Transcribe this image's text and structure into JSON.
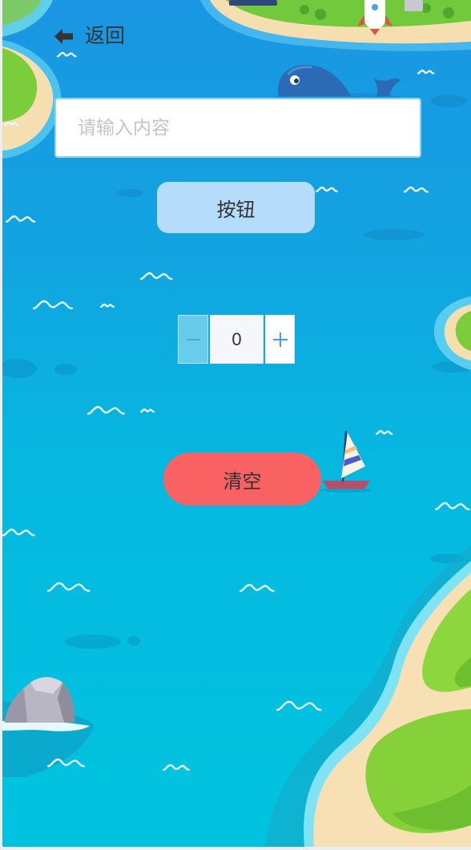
{
  "header": {
    "back_label": "返回",
    "back_icon": "arrow-left-icon"
  },
  "form": {
    "text_input": {
      "placeholder": "请输入内容",
      "value": ""
    },
    "button_label": "按钮"
  },
  "stepper": {
    "value": "0",
    "decrement_icon": "minus-icon",
    "increment_icon": "plus-icon",
    "decrement_disabled": true
  },
  "actions": {
    "clear_label": "清空"
  },
  "colors": {
    "text_color": "#333333",
    "input_border": "#8fd2f3",
    "primary_button_bg": "#b6dcfb",
    "clear_button_bg": "#f96262",
    "increment_icon_color": "#409eff",
    "water_top": "#1a96e2",
    "water_bottom": "#00c4df"
  },
  "background_icons": [
    "island-icon",
    "whale-icon",
    "sailboat-icon",
    "rock-icon",
    "rocket-icon",
    "wave-icon"
  ]
}
